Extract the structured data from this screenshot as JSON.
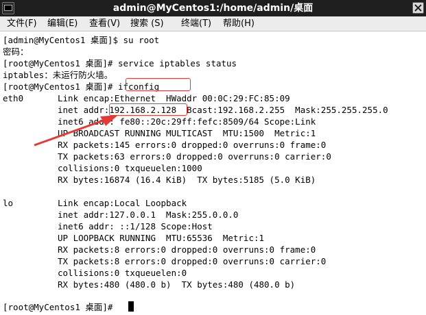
{
  "window": {
    "title": "admin@MyCentos1:/home/admin/桌面"
  },
  "menu": [
    {
      "label": "文件(F)"
    },
    {
      "label": "编辑(E)"
    },
    {
      "label": "查看(V)"
    },
    {
      "label": "搜索 (S)"
    },
    {
      "label": "终端(T)"
    },
    {
      "label": "帮助(H)"
    }
  ],
  "terminal": {
    "lines": [
      "[admin@MyCentos1 桌面]$ su root",
      "密码：",
      "[root@MyCentos1 桌面]# service iptables status",
      "iptables：未运行防火墙。",
      "[root@MyCentos1 桌面]# ifconfig",
      "eth0",
      "lo",
      "[root@MyCentos1 桌面]# "
    ],
    "eth0": [
      "Link encap:Ethernet  HWaddr 00:0C:29:FC:85:09",
      "inet addr:192.168.2.128  Bcast:192.168.2.255  Mask:255.255.255.0",
      "inet6 addr: fe80::20c:29ff:fefc:8509/64 Scope:Link",
      "UP BROADCAST RUNNING MULTICAST  MTU:1500  Metric:1",
      "RX packets:145 errors:0 dropped:0 overruns:0 frame:0",
      "TX packets:63 errors:0 dropped:0 overruns:0 carrier:0",
      "collisions:0 txqueuelen:1000",
      "RX bytes:16874 (16.4 KiB)  TX bytes:5185 (5.0 KiB)"
    ],
    "lo": [
      "Link encap:Local Loopback",
      "inet addr:127.0.0.1  Mask:255.0.0.0",
      "inet6 addr: ::1/128 Scope:Host",
      "UP LOOPBACK RUNNING  MTU:65536  Metric:1",
      "RX packets:8 errors:0 dropped:0 overruns:0 frame:0",
      "TX packets:8 errors:0 dropped:0 overruns:0 carrier:0",
      "collisions:0 txqueuelen:0",
      "RX bytes:480 (480.0 b)  TX bytes:480 (480.0 b)"
    ]
  },
  "annotations": {
    "color": "#e53935"
  }
}
